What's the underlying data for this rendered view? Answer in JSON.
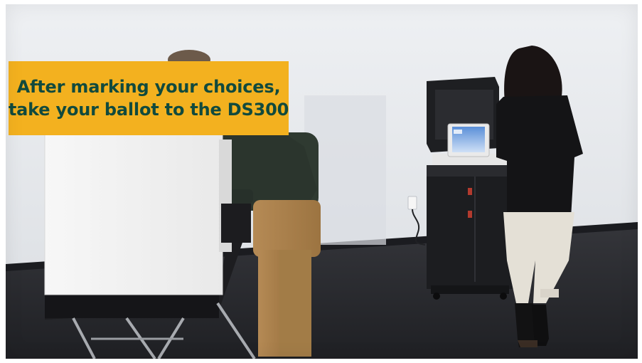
{
  "caption": {
    "line1": "After marking your choices,",
    "line2": "take your ballot to the DS300"
  },
  "colors": {
    "caption_background": "#f3b11f",
    "caption_text": "#114a3d",
    "wall": "#e7eaee",
    "carpet": "#2b2c30"
  },
  "scene": {
    "objects": [
      "voting-booth",
      "voter-at-booth",
      "ballot-tabulator",
      "voter-walking",
      "power-outlet"
    ]
  }
}
